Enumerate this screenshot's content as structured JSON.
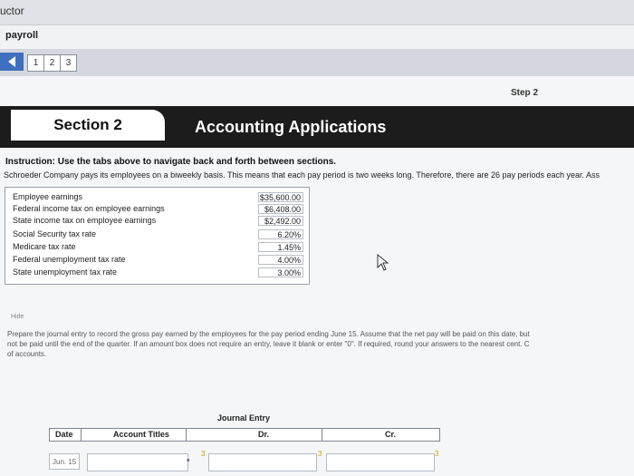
{
  "window": {
    "app_title": "uctor",
    "course": "payroll"
  },
  "nav": {
    "tabs": [
      "1",
      "2",
      "3"
    ]
  },
  "step": "Step 2",
  "section": {
    "tab_label": "Section 2",
    "name": "Accounting Applications"
  },
  "instruction": "Instruction: Use the tabs above to navigate back and forth between sections.",
  "intro": "Schroeder Company pays its employees on a biweekly basis. This means that each pay period is two weeks long. Therefore, there are 26 pay periods each year. Ass",
  "info_table": [
    {
      "label": "Employee earnings",
      "value": "$35,600.00"
    },
    {
      "label": "Federal income tax on employee earnings",
      "value": "$6,408.00"
    },
    {
      "label": "State income tax on employee earnings",
      "value": "$2,492.00"
    },
    {
      "label": "Social Security tax rate",
      "value": "6.20%"
    },
    {
      "label": "Medicare tax rate",
      "value": "1.45%"
    },
    {
      "label": "Federal unemployment tax rate",
      "value": "4.00%"
    },
    {
      "label": "State unemployment tax rate",
      "value": "3.00%"
    }
  ],
  "hide_link": "Hide",
  "prompt_lines": [
    "Prepare the journal entry to record the gross pay earned by the employees for the pay period ending June 15. Assume that the net pay will be paid on this date, but",
    "not be paid until the end of the quarter. If an amount box does not require an entry, leave it blank or enter \"0\". If required, round your answers to the nearest cent. C",
    "of accounts."
  ],
  "journal": {
    "title": "Journal Entry",
    "columns": {
      "date": "Date",
      "account": "Account Titles",
      "dr": "Dr.",
      "cr": "Cr."
    },
    "rows": [
      {
        "date": "Jun. 15"
      }
    ],
    "markers": [
      "3",
      "3",
      "3"
    ]
  },
  "colors": {
    "header_band": "#1c1c1c",
    "nav_arrow": "#3f6fbf",
    "marker": "#c7a400"
  },
  "icons": {
    "cursor": "mouse-pointer-icon",
    "back": "arrow-left-icon"
  }
}
